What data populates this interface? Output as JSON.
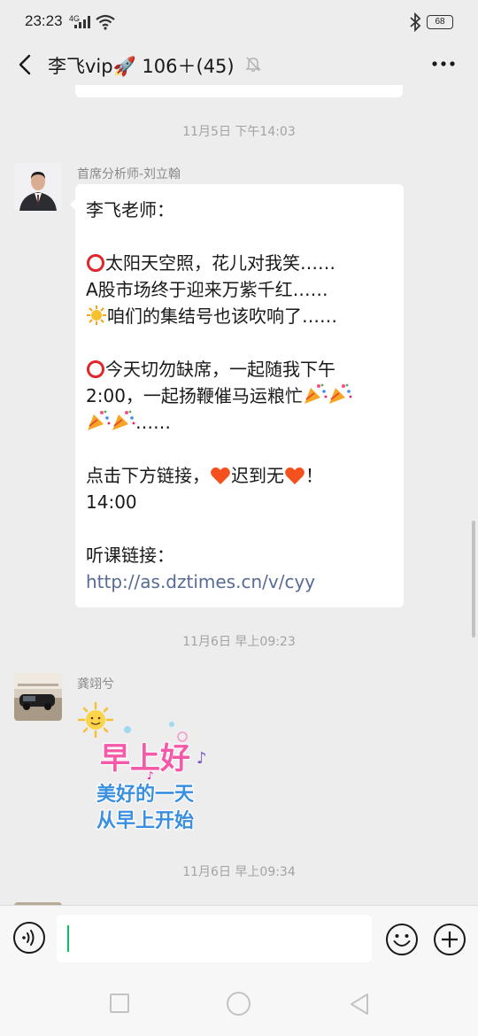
{
  "status_bar": {
    "time": "23:23",
    "network": "4G",
    "battery": "68"
  },
  "header": {
    "title": "李飞vip🚀 106＋(45)"
  },
  "messages": [
    {
      "timestamp": "11月5日 下午14:03",
      "sender": "首席分析师-刘立翰",
      "lines": {
        "l1": "李飞老师：",
        "l2": "太阳天空照，花儿对我笑……",
        "l3": "A股市场终于迎来万紫千红……",
        "l4": "咱们的集结号也该吹响了……",
        "l5a": "今天切勿缺席，一起随我下午",
        "l5b": "2:00，一起扬鞭催马运粮忙",
        "l5c": "……",
        "l6a": "点击下方链接，",
        "l6b": "迟到无",
        "l6c": "！",
        "l7": "14:00",
        "l8": "听课链接：",
        "link": "http://as.dztimes.cn/v/cyy"
      }
    },
    {
      "timestamp": "11月6日 早上09:23",
      "sender": "龚翊兮",
      "sticker": {
        "line1": "早上好",
        "line2": "美好的一天",
        "line3": "从早上开始"
      }
    },
    {
      "timestamp": "11月6日 早上09:34"
    }
  ],
  "icons": {
    "back": "chevron-left-icon",
    "mute": "bell-off-icon",
    "more": "more-dots-icon",
    "voice": "voice-icon",
    "emoji": "smiley-icon",
    "plus": "plus-icon"
  },
  "colors": {
    "link": "#576b95",
    "caret": "#07c160",
    "background": "#ededed"
  }
}
